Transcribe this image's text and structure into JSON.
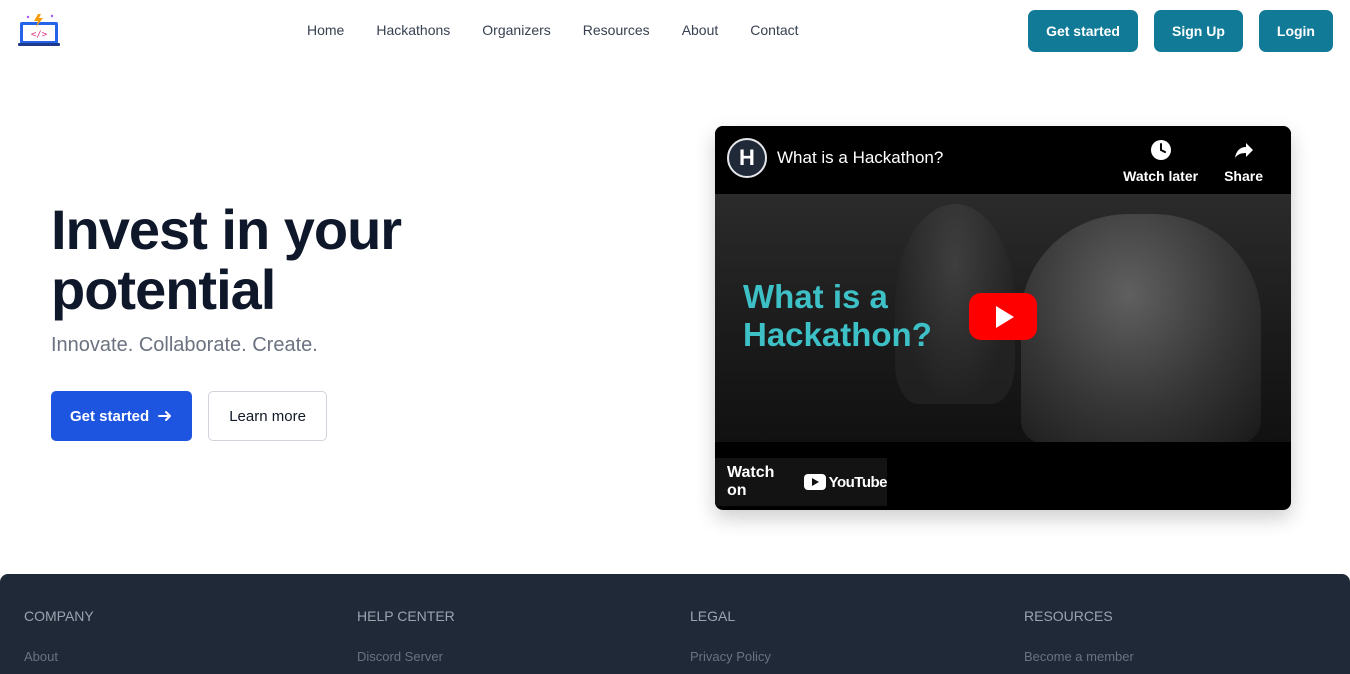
{
  "nav": {
    "items": [
      "Home",
      "Hackathons",
      "Organizers",
      "Resources",
      "About",
      "Contact"
    ],
    "actions": [
      "Get started",
      "Sign Up",
      "Login"
    ]
  },
  "hero": {
    "title_line1": "Invest in your",
    "title_line2": "potential",
    "subtitle": "Innovate. Collaborate. Create.",
    "primary_button": "Get started",
    "secondary_button": "Learn more"
  },
  "video": {
    "title": "What is a Hackathon?",
    "channel_initial": "H",
    "watch_later": "Watch later",
    "share": "Share",
    "thumb_line1": "What is a",
    "thumb_line2": "Hackathon?",
    "watch_on": "Watch on",
    "youtube": "YouTube"
  },
  "footer": {
    "columns": [
      {
        "heading": "COMPANY",
        "first_link": "About"
      },
      {
        "heading": "HELP CENTER",
        "first_link": "Discord Server"
      },
      {
        "heading": "LEGAL",
        "first_link": "Privacy Policy"
      },
      {
        "heading": "RESOURCES",
        "first_link": "Become a member"
      }
    ]
  },
  "colors": {
    "brand_teal": "#117a96",
    "primary_blue": "#1d55e0",
    "footer_bg": "#1f2937",
    "youtube_red": "#ff0000",
    "thumb_text": "#3dc1c6"
  }
}
